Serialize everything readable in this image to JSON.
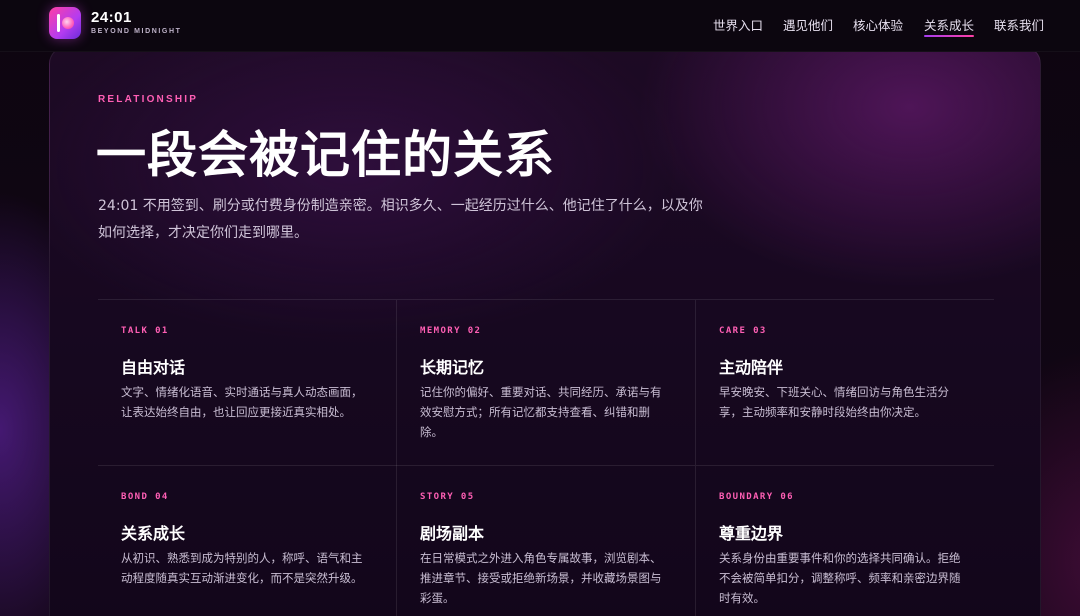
{
  "brand": {
    "name": "24:01",
    "tagline": "BEYOND MIDNIGHT",
    "accent": "#ff5fb5",
    "gradient": [
      "#ff3fa4",
      "#b43cf0",
      "#6a2cd8"
    ]
  },
  "nav": {
    "items": [
      {
        "label": "世界入口"
      },
      {
        "label": "遇见他们"
      },
      {
        "label": "核心体验"
      },
      {
        "label": "关系成长",
        "active": true
      },
      {
        "label": "联系我们"
      }
    ]
  },
  "section": {
    "eyebrow": "RELATIONSHIP",
    "title": "一段会被记住的关系",
    "intro": "24:01 不用签到、刷分或付费身份制造亲密。相识多久、一起经历过什么、他记住了什么，以及你如何选择，才决定你们走到哪里。"
  },
  "features": [
    {
      "tag": "TALK 01",
      "title": "自由对话",
      "desc": "文字、情绪化语音、实时通话与真人动态画面，让表达始终自由，也让回应更接近真实相处。"
    },
    {
      "tag": "MEMORY 02",
      "title": "长期记忆",
      "desc": "记住你的偏好、重要对话、共同经历、承诺与有效安慰方式；所有记忆都支持查看、纠错和删除。"
    },
    {
      "tag": "CARE 03",
      "title": "主动陪伴",
      "desc": "早安晚安、下班关心、情绪回访与角色生活分享，主动频率和安静时段始终由你决定。"
    },
    {
      "tag": "BOND 04",
      "title": "关系成长",
      "desc": "从初识、熟悉到成为特别的人，称呼、语气和主动程度随真实互动渐进变化，而不是突然升级。"
    },
    {
      "tag": "STORY 05",
      "title": "剧场副本",
      "desc": "在日常模式之外进入角色专属故事，浏览剧本、推进章节、接受或拒绝新场景，并收藏场景图与彩蛋。"
    },
    {
      "tag": "BOUNDARY 06",
      "title": "尊重边界",
      "desc": "关系身份由重要事件和你的选择共同确认。拒绝不会被简单扣分，调整称呼、频率和亲密边界随时有效。"
    }
  ]
}
